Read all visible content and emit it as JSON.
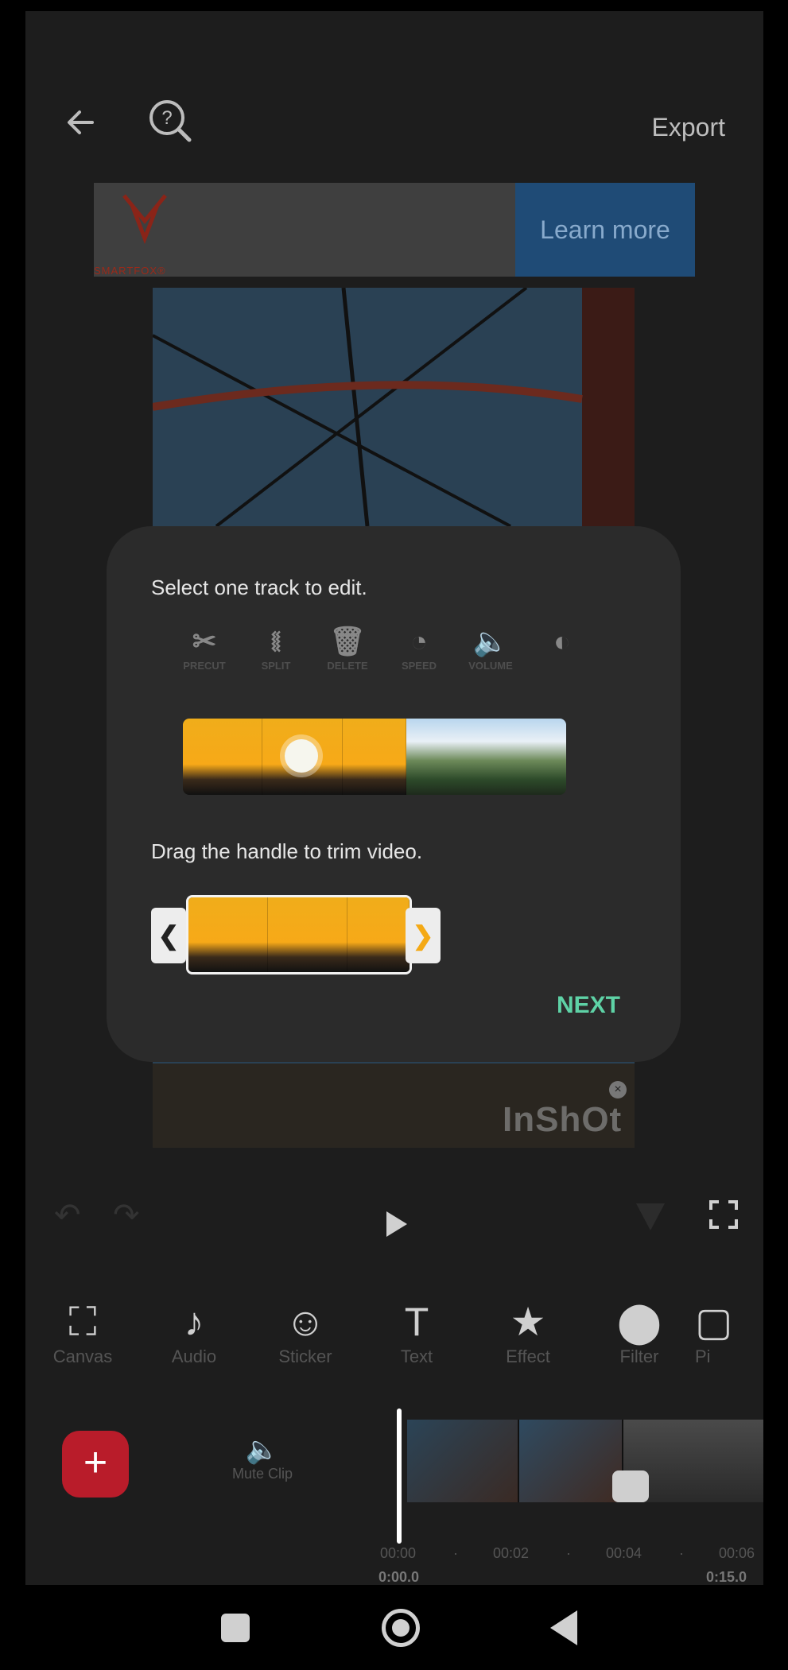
{
  "topbar": {
    "export_label": "Export",
    "back_icon": "arrow-left-icon",
    "help_icon": "help-search-icon"
  },
  "ad": {
    "brand": "SMARTFOX®",
    "cta": "Learn more"
  },
  "watermark": "InShOt",
  "dialog": {
    "select_text": "Select one track to edit.",
    "tools": [
      {
        "label": "PRECUT",
        "icon": "✂"
      },
      {
        "label": "SPLIT",
        "icon": "⧛"
      },
      {
        "label": "DELETE",
        "icon": "🗑"
      },
      {
        "label": "SPEED",
        "icon": "◔"
      },
      {
        "label": "VOLUME",
        "icon": "🔈"
      },
      {
        "label": "",
        "icon": "◐"
      }
    ],
    "trim_text": "Drag the handle to trim video.",
    "left_handle": "❮",
    "right_handle": "❯",
    "next_label": "NEXT"
  },
  "toolbar": [
    {
      "label": "Canvas",
      "icon": "⛶"
    },
    {
      "label": "Audio",
      "icon": "♪"
    },
    {
      "label": "Sticker",
      "icon": "☺"
    },
    {
      "label": "Text",
      "icon": "T"
    },
    {
      "label": "Effect",
      "icon": "★"
    },
    {
      "label": "Filter",
      "icon": "⬤"
    },
    {
      "label": "Pi",
      "icon": "▢"
    }
  ],
  "timeline": {
    "add_label": "+",
    "mute_label": "Mute Clip",
    "ticks": [
      "00:00",
      "00:02",
      "00:04",
      "00:06"
    ],
    "current_time": "0:00.0",
    "total_time": "0:15.0"
  },
  "colors": {
    "accent": "#5ed2a6",
    "add_button": "#b91c2a",
    "ad_cta": "#1f4b76"
  }
}
